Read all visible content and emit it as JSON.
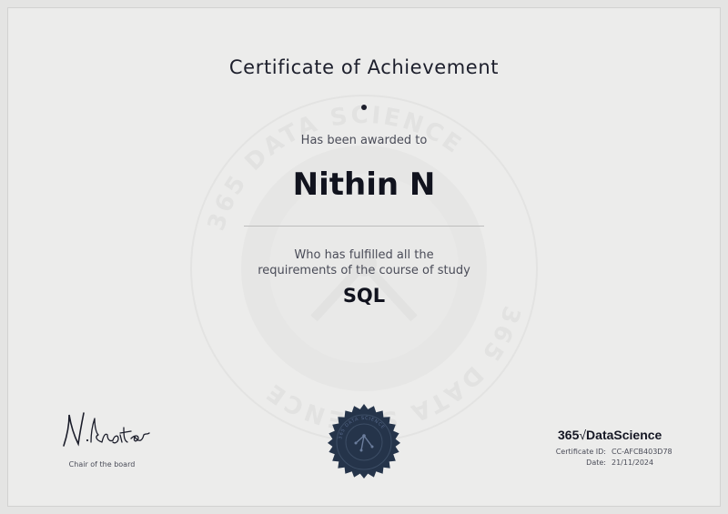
{
  "certificate": {
    "title": "Certificate of Achievement",
    "awarded_line": "Has been awarded to",
    "recipient_name": "Nithin N",
    "fulfilled_line1": "Who has fulfilled all the",
    "fulfilled_line2": "requirements of the course of study",
    "course_name": "SQL"
  },
  "watermark": {
    "text": "365 DATA SCIENCE"
  },
  "signature": {
    "signer_script": "N.Krastev",
    "caption": "Chair of the board"
  },
  "brand": {
    "logo_prefix": "365",
    "logo_root": "√",
    "logo_suffix": "DataScience",
    "seal_text": "365 DATA SCIENCE"
  },
  "meta": {
    "certificate_id_label": "Certificate ID:",
    "certificate_id_value": "CC-AFCB403D78",
    "date_label": "Date:",
    "date_value": "21/11/2024"
  },
  "colors": {
    "background": "#ececeb",
    "ink": "#1d1f2c",
    "seal": "#25344a"
  }
}
